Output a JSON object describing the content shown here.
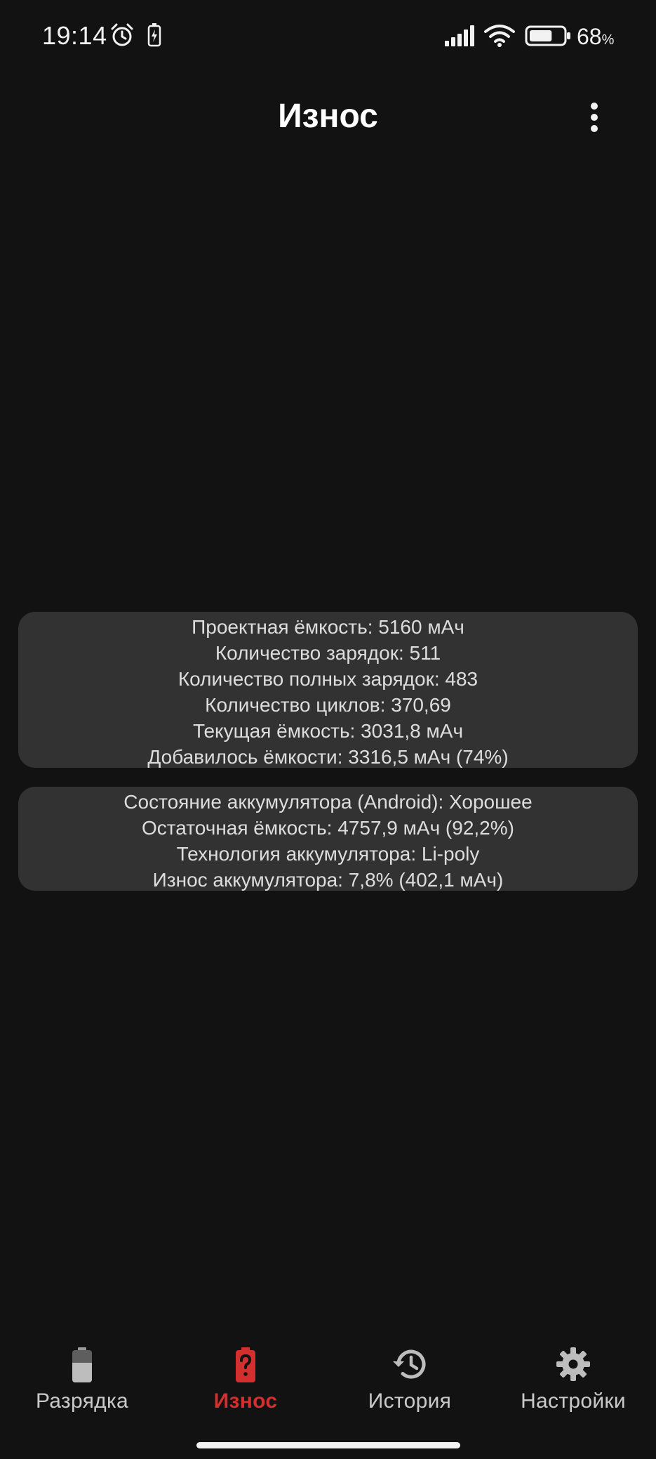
{
  "status_bar": {
    "time": "19:14",
    "battery_percent": "68",
    "battery_percent_sign": "%",
    "battery_level": 0.68,
    "icons": [
      "alarm-icon",
      "charging-icon",
      "signal-icon",
      "wifi-icon",
      "battery-icon"
    ]
  },
  "header": {
    "title": "Износ",
    "menu_icon": "more-vertical-icon"
  },
  "card_capacity": {
    "lines": [
      "Проектная ёмкость: 5160 мАч",
      "Количество зарядок: 511",
      "Количество полных зарядок: 483",
      "Количество циклов: 370,69",
      "Текущая ёмкость: 3031,8 мАч",
      "Добавилось ёмкости: 3316,5 мАч (74%)"
    ]
  },
  "card_health": {
    "lines": [
      "Состояние аккумулятора (Android): Хорошее",
      "Остаточная ёмкость: 4757,9 мАч (92,2%)",
      "Технология аккумулятора: Li-poly",
      "Износ аккумулятора: 7,8% (402,1 мАч)"
    ]
  },
  "bottom_nav": {
    "items": [
      {
        "label": "Разрядка",
        "icon": "battery-icon",
        "active": false
      },
      {
        "label": "Износ",
        "icon": "battery-alert-icon",
        "active": true
      },
      {
        "label": "История",
        "icon": "history-icon",
        "active": false
      },
      {
        "label": "Настройки",
        "icon": "settings-gear-icon",
        "active": false
      }
    ]
  },
  "colors": {
    "background": "#121212",
    "card": "#323232",
    "accent": "#d32f2f",
    "nav_inactive": "#c9c9c9"
  }
}
